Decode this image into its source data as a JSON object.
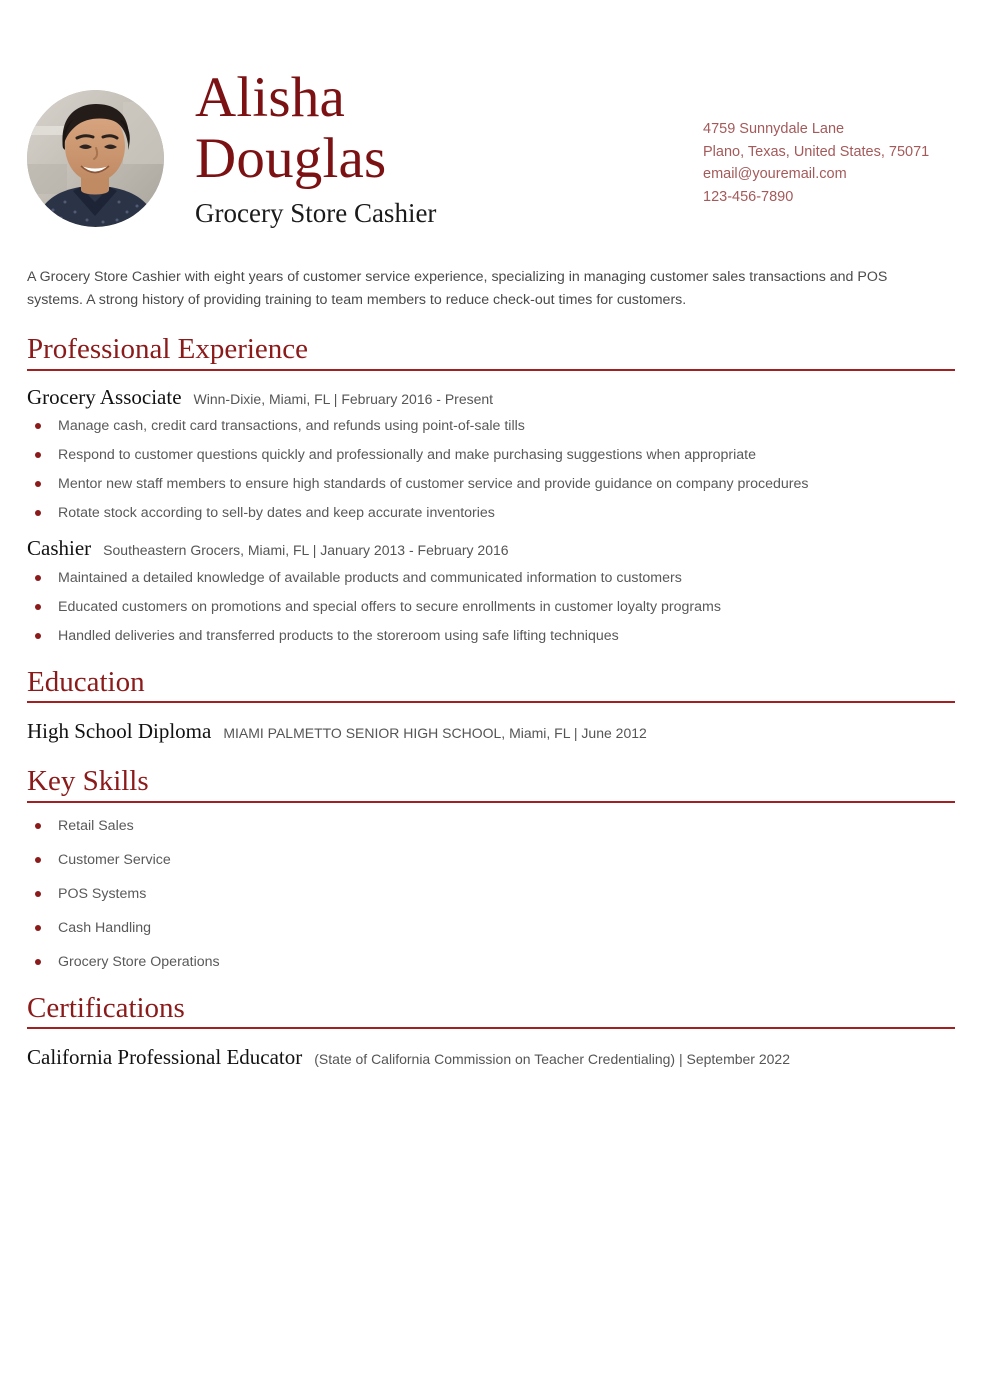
{
  "header": {
    "first_name": "Alisha",
    "last_name": "Douglas",
    "job_title": "Grocery Store Cashier",
    "avatar_alt": "portrait-photo",
    "contact": [
      "4759 Sunnydale Lane",
      "Plano, Texas, United States, 75071",
      "email@youremail.com",
      "123-456-7890"
    ]
  },
  "summary": "A Grocery Store Cashier with eight years of customer service experience,  specializing in managing customer sales transactions and POS systems. A  strong history of providing training to team members to reduce  check-out times for customers.",
  "sections": {
    "experience": {
      "title": "Professional Experience",
      "entries": [
        {
          "title": "Grocery Associate",
          "meta": "Winn-Dixie, Miami, FL | February 2016 - Present",
          "bullets": [
            "Manage cash, credit card transactions, and refunds using point-of-sale tills",
            "Respond to customer questions quickly and professionally and make purchasing suggestions when appropriate",
            "Mentor new staff members to ensure high standards of customer service and provide guidance on company procedures",
            "Rotate stock according to sell-by dates and keep accurate inventories"
          ]
        },
        {
          "title": "Cashier",
          "meta": "Southeastern Grocers, Miami, FL | January 2013 - February 2016",
          "bullets": [
            "Maintained a detailed knowledge of available products and communicated information to customers",
            "Educated customers on promotions and special offers to secure enrollments in customer loyalty programs",
            "Handled deliveries and transferred products to the storeroom using safe lifting techniques"
          ]
        }
      ]
    },
    "education": {
      "title": "Education",
      "entries": [
        {
          "title": "High School Diploma",
          "meta": "MIAMI PALMETTO SENIOR HIGH SCHOOL, Miami, FL | June 2012"
        }
      ]
    },
    "skills": {
      "title": "Key Skills",
      "items": [
        "Retail Sales",
        "Customer Service",
        "POS Systems",
        "Cash Handling",
        "Grocery Store Operations"
      ]
    },
    "certifications": {
      "title": "Certifications",
      "entries": [
        {
          "title": "California Professional Educator",
          "meta": "(State of California Commission on Teacher Credentialing) | September 2022"
        }
      ]
    }
  },
  "colors": {
    "accent": "#8B1A1A",
    "name": "#7B1113",
    "rule": "#A32020",
    "contact_text": "#A45A5A",
    "body_text": "#595959"
  }
}
